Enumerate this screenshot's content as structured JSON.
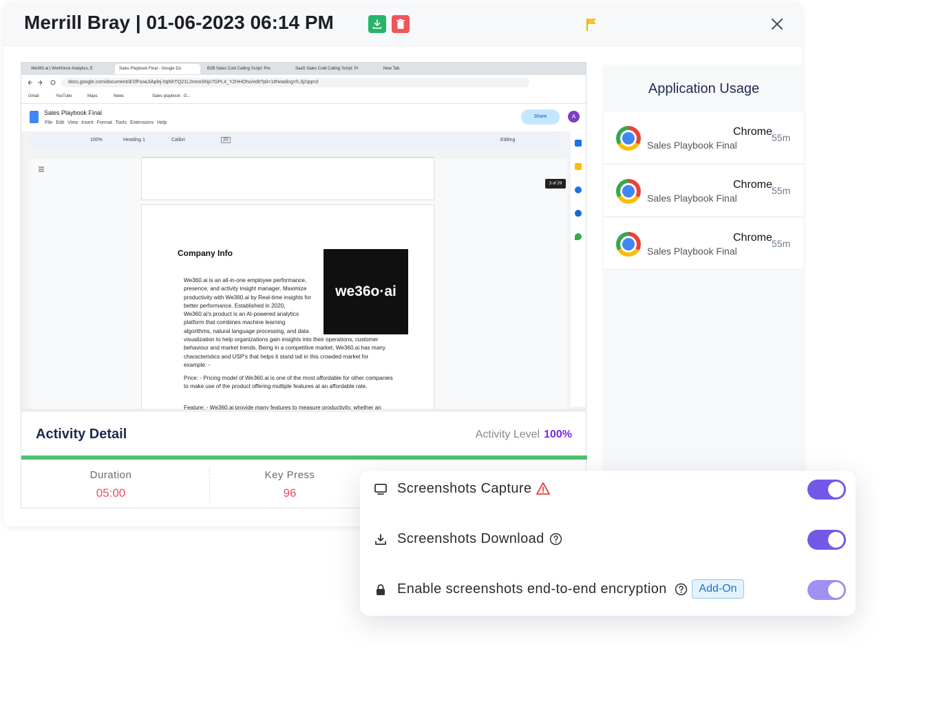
{
  "header": {
    "title": "Merrill Bray | 01-06-2023 06:14 PM"
  },
  "browser": {
    "tabs": [
      "We360.ai | Workforce Analytics, E",
      "Sales Playbook Final - Google Do",
      "B2B Sales Cold Calling Script: Pro",
      "SaaS Sales Cold Calling Script: Pr",
      "New Tab"
    ],
    "url": "docs.google.com/document/d/1fFsoaJiAplej-0qNhTQ21L2nmoSNjc7GPL4_YZHHOho/edit?pli=1#heading=h.3j2qqm3",
    "bookmarks": [
      "Gmail",
      "YouTube",
      "Maps",
      "News",
      "Sales playbook - G..."
    ]
  },
  "doc": {
    "title": "Sales Playbook Final",
    "menu": "File  Edit  View  Insert  Format  Tools  Extensions  Help",
    "share": "Share",
    "avatar": "A",
    "zoom": "100%",
    "style": "Heading 1",
    "font": "Calibri",
    "font_size": "20",
    "mode": "Editing",
    "page_count": "3 of 29",
    "heading": "Company Info",
    "logo_text": "we36o·ai",
    "para1_lines_narrow": [
      "We360.ai is an all-in-one employee performance,",
      "presence, and activity insight manager. Maximize",
      "productivity with We360.ai by Real-time insights for",
      "better performance. Established in 2020,",
      "We360.ai's product is an AI-powered analytics",
      "platform that combines machine learning",
      "algorithms, natural language processing, and data"
    ],
    "para1_lines_wide": [
      "visualization to help organizations gain insights into their operations, customer",
      "behaviour and market trends. Being in a competitive market, We360.ai has many",
      "characteristics and USP's that helps it stand tall in this crowded market for",
      "example: -"
    ],
    "para2": "Price: - Pricing model of We360.ai is one of the most affordable for other companies to make use of the product offering multiple features at an affordable rate.",
    "para3": "Feature: - We360.ai provide many features to measure productivity, whether an"
  },
  "app_usage": {
    "title": "Application Usage",
    "rows": [
      {
        "app": "Chrome",
        "detail": "Sales Playbook Final",
        "time": "55m"
      },
      {
        "app": "Chrome",
        "detail": "Sales Playbook Final",
        "time": "55m"
      },
      {
        "app": "Chrome",
        "detail": "Sales Playbook Final",
        "time": "55m"
      }
    ]
  },
  "activity": {
    "title": "Activity Detail",
    "level_label": "Activity Level",
    "level_value": "100%",
    "level_fraction": 1.0,
    "metrics": [
      {
        "label": "Duration",
        "value": "05:00"
      },
      {
        "label": "Key Press",
        "value": "96"
      }
    ]
  },
  "settings": [
    {
      "label": "Screenshots Capture",
      "enabled": true,
      "icon": "monitor-icon",
      "extra": "warning-icon"
    },
    {
      "label": "Screenshots Download",
      "enabled": true,
      "icon": "download-icon",
      "extra": "help-icon"
    },
    {
      "label": "Enable screenshots end-to-end encryption",
      "enabled": true,
      "icon": "lock-icon",
      "extra": "help-icon",
      "badge": "Add-On"
    }
  ],
  "colors": {
    "accent": "#7358e8",
    "success": "#27b36b",
    "danger": "#f2545b",
    "activity_level": "#7a2ce8",
    "metric_value": "#ef4d5e"
  }
}
